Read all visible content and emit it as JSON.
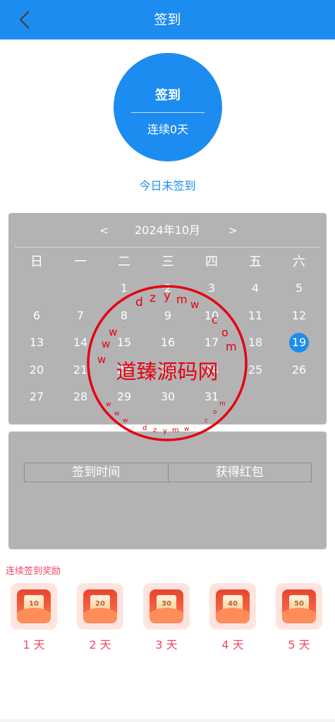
{
  "header": {
    "title": "签到",
    "back_icon": "chevron-left-icon"
  },
  "signin": {
    "button_label": "签到",
    "streak_label": "连续0天",
    "status": "今日未签到"
  },
  "calendar": {
    "prev": "<",
    "next": ">",
    "title": "2024年10月",
    "weekdays": [
      "日",
      "一",
      "二",
      "三",
      "四",
      "五",
      "六"
    ],
    "weeks": [
      [
        "",
        "",
        "1",
        "2",
        "3",
        "4",
        "5"
      ],
      [
        "6",
        "7",
        "8",
        "9",
        "10",
        "11",
        "12"
      ],
      [
        "13",
        "14",
        "15",
        "16",
        "17",
        "18",
        "19"
      ],
      [
        "20",
        "21",
        "22",
        "23",
        "24",
        "25",
        "26"
      ],
      [
        "27",
        "28",
        "29",
        "30",
        "31",
        "",
        ""
      ]
    ],
    "today": "19"
  },
  "records": {
    "columns": [
      "签到时间",
      "获得红包"
    ]
  },
  "rewards": {
    "title": "连续签到奖励",
    "items": [
      {
        "amount": "10",
        "label": "1 天"
      },
      {
        "amount": "20",
        "label": "2 天"
      },
      {
        "amount": "30",
        "label": "3 天"
      },
      {
        "amount": "40",
        "label": "4 天"
      },
      {
        "amount": "50",
        "label": "5 天"
      }
    ]
  },
  "watermark": {
    "text": "道臻源码网",
    "ring_text": "www.dzymw.com"
  },
  "colors": {
    "primary": "#1d8cf0",
    "panel": "#b3b3b3",
    "accent": "#f04864",
    "stamp": "#e60012"
  }
}
